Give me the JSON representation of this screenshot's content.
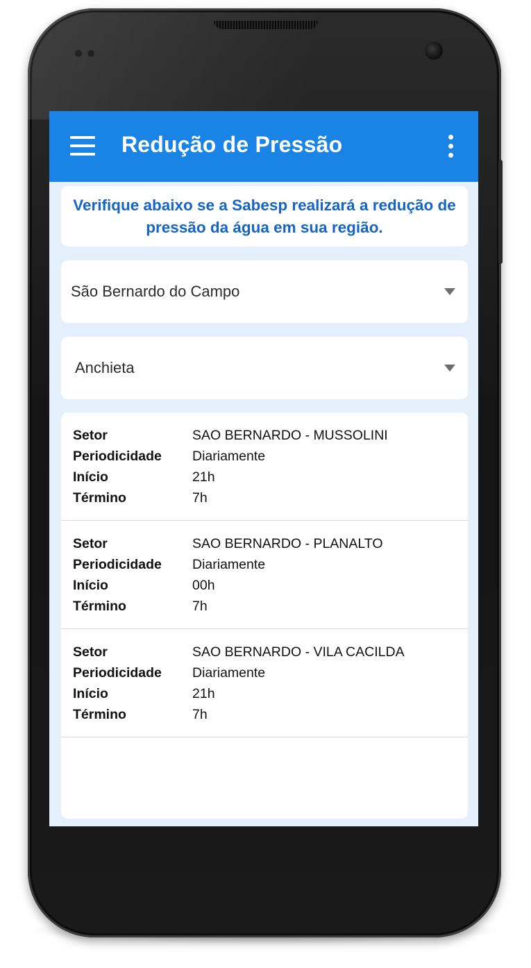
{
  "app": {
    "title": "Redução de Pressão"
  },
  "info": {
    "message": "Verifique abaixo se a Sabesp realizará a redução de pressão da água em sua região."
  },
  "filters": {
    "city": "São Bernardo do Campo",
    "neighborhood": "Anchieta"
  },
  "field_labels": {
    "setor": "Setor",
    "periodicidade": "Periodicidade",
    "inicio": "Início",
    "termino": "Término"
  },
  "results": [
    {
      "setor": "SAO BERNARDO - MUSSOLINI",
      "periodicidade": "Diariamente",
      "inicio": "21h",
      "termino": "7h"
    },
    {
      "setor": "SAO BERNARDO - PLANALTO",
      "periodicidade": "Diariamente",
      "inicio": "00h",
      "termino": "7h"
    },
    {
      "setor": "SAO BERNARDO - VILA CACILDA",
      "periodicidade": "Diariamente",
      "inicio": "21h",
      "termino": "7h"
    }
  ],
  "icons": {
    "menu": "hamburger-menu-icon",
    "more": "more-vertical-icon",
    "dropdown": "dropdown-arrow-icon"
  },
  "colors": {
    "appbar": "#1a84e6",
    "screen_background": "#e4f0fc",
    "info_text": "#1565c6",
    "device_body": "#1a1a1a"
  }
}
